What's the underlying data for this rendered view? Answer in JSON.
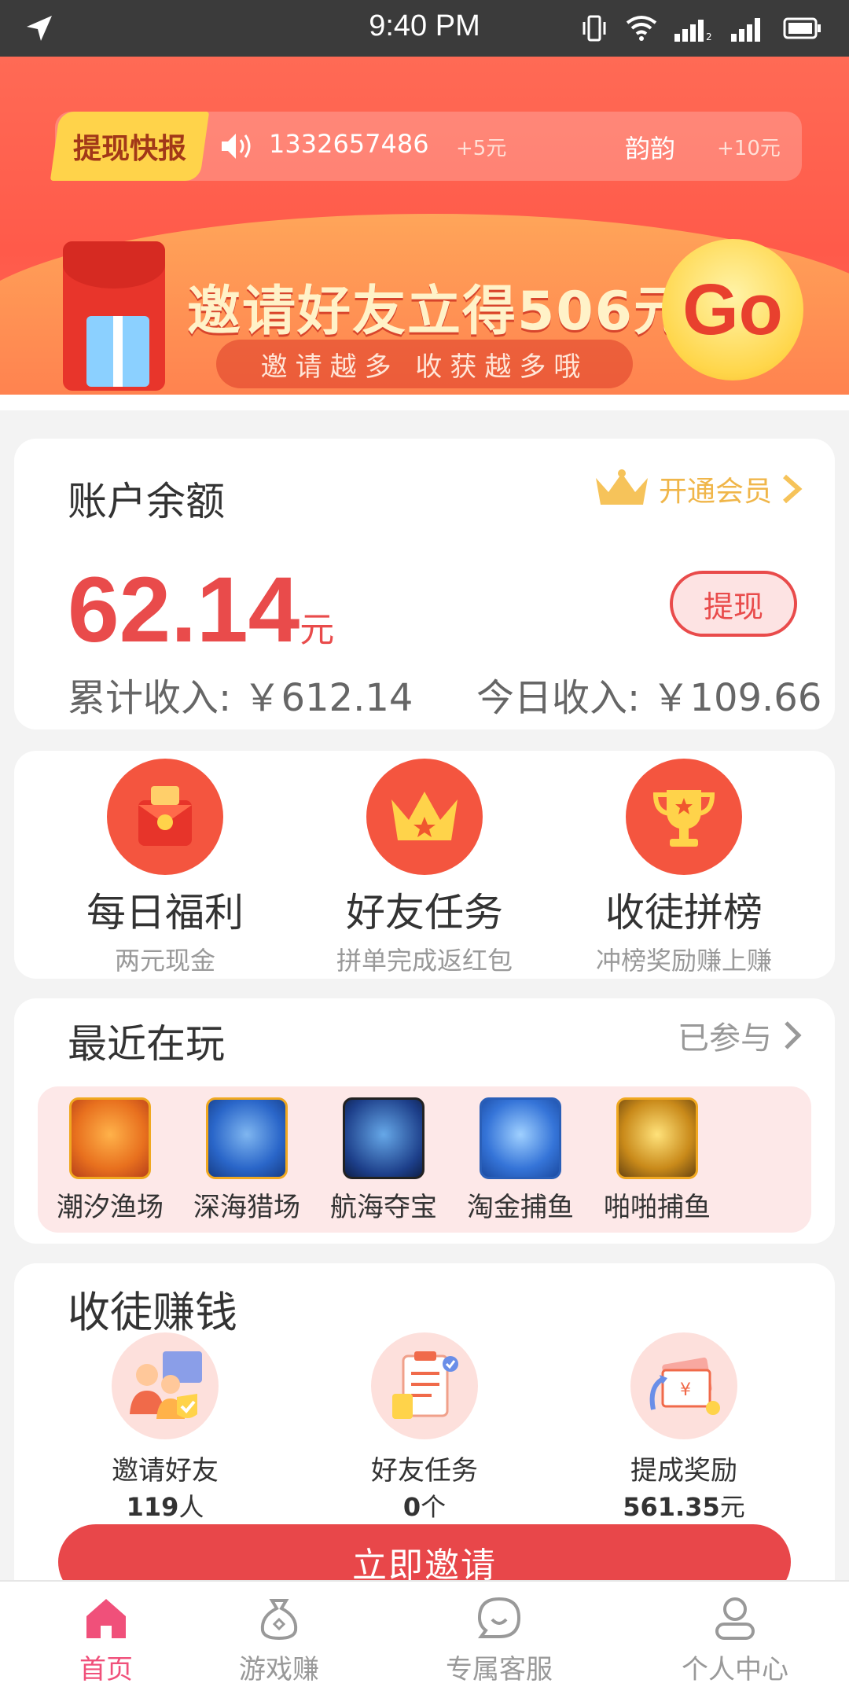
{
  "status_bar": {
    "time": "9:40 PM"
  },
  "banner": {
    "ticker_tag": "提现快报",
    "ticker_phone": "1332657486",
    "ticker_amount1": "+5元",
    "ticker_name": "韵韵",
    "ticker_amount2": "+10元",
    "headline": "邀请好友立得506元",
    "subline": "邀请越多 收获越多哦",
    "go_label": "Go"
  },
  "balance": {
    "label": "账户余额",
    "vip_label": "开通会员",
    "amount": "62.14",
    "unit": "元",
    "withdraw_label": "提现",
    "total_label": "累计收入:",
    "total_value": "￥612.14",
    "today_label": "今日收入:",
    "today_value": "￥109.66"
  },
  "features": [
    {
      "title": "每日福利",
      "sub": "两元现金",
      "icon": "red-envelope-icon"
    },
    {
      "title": "好友任务",
      "sub": "拼单完成返红包",
      "icon": "crown-icon"
    },
    {
      "title": "收徒拼榜",
      "sub": "冲榜奖励赚上赚",
      "icon": "trophy-icon"
    }
  ],
  "recent": {
    "title": "最近在玩",
    "more_label": "已参与",
    "games": [
      {
        "name": "潮汐渔场",
        "color": "#f7a928"
      },
      {
        "name": "深海猎场",
        "color": "#2a66c9"
      },
      {
        "name": "航海夺宝",
        "color": "#1d3f8a"
      },
      {
        "name": "淘金捕鱼",
        "color": "#3574d8"
      },
      {
        "name": "啪啪捕鱼",
        "color": "#c98a1a"
      }
    ]
  },
  "recruit": {
    "title": "收徒赚钱",
    "items": [
      {
        "label": "邀请好友",
        "value": "119",
        "unit": "人"
      },
      {
        "label": "好友任务",
        "value": "0",
        "unit": "个"
      },
      {
        "label": "提成奖励",
        "value": "561.35",
        "unit": "元"
      }
    ],
    "invite_label": "立即邀请"
  },
  "tabs": [
    {
      "label": "首页",
      "active": true
    },
    {
      "label": "游戏赚",
      "active": false
    },
    {
      "label": "专属客服",
      "active": false
    },
    {
      "label": "个人中心",
      "active": false
    }
  ],
  "colors": {
    "accent": "#e94b4b",
    "tab_active": "#f0507a",
    "banner": "#ff5a4a"
  }
}
